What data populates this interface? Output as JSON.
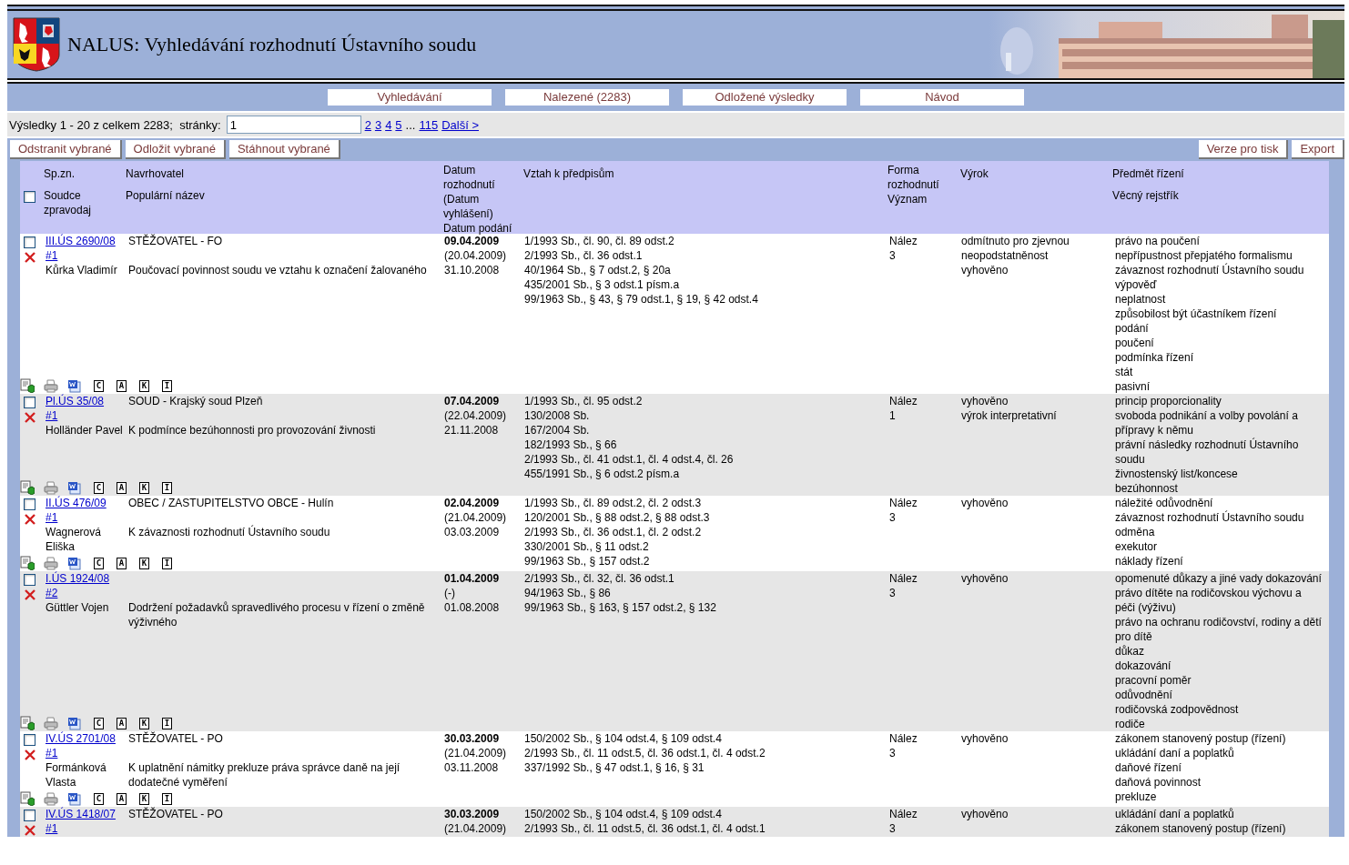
{
  "header": {
    "title": "NALUS: Vyhledávání rozhodnutí Ústavního soudu"
  },
  "nav_tabs": [
    {
      "label": "Vyhledávání"
    },
    {
      "label": "Nalezené (2283)"
    },
    {
      "label": "Odložené výsledky"
    },
    {
      "label": "Návod"
    }
  ],
  "pagination": {
    "summary": "Výsledky 1 - 20 z celkem 2283;  stránky:",
    "page_value": "1",
    "pages": [
      "2",
      "3",
      "4",
      "5"
    ],
    "ellipsis": "...",
    "last_page": "115",
    "next": "Další >"
  },
  "actions_left": [
    "Odstranit vybrané",
    "Odložit vybrané",
    "Stáhnout vybrané"
  ],
  "actions_right": [
    "Verze pro tisk",
    "Export"
  ],
  "table_header": {
    "select_all_checked": false,
    "case_no": "Sp.zn.",
    "judge": "Soudce zpravodaj",
    "petitioner": "Navrhovatel",
    "popular_name": "Populární název",
    "dates": "Datum rozhodnutí (Datum vyhlášení) Datum podání",
    "regulations": "Vztah k předpisům",
    "form": "Forma rozhodnutí",
    "significance": "Význam",
    "verdict": "Výrok",
    "subject": "Předmět řízení",
    "index": "Věcný rejstřík"
  },
  "rows": [
    {
      "checked": false,
      "case_no": "III.ÚS 2690/08",
      "ref": "#1",
      "judge": "Kůrka Vladimír",
      "petitioner": "STĚŽOVATEL - FO",
      "popular_name": "Poučovací povinnost soudu ve vztahu k označení žalovaného",
      "decided": "09.04.2009",
      "announced": "(20.04.2009)",
      "filed": "31.10.2008",
      "regulations": [
        "1/1993 Sb., čl. 90, čl. 89 odst.2",
        "2/1993 Sb., čl. 36 odst.1",
        "40/1964 Sb., § 7 odst.2, § 20a",
        "435/2001 Sb., § 3 odst.1 písm.a",
        "99/1963 Sb., § 43, § 79 odst.1, § 19, § 42 odst.4"
      ],
      "form": "Nález",
      "significance": "3",
      "verdict": [
        "odmítnuto pro zjevnou neopodstatněnost",
        "vyhověno"
      ],
      "subjects": [
        "právo na poučení",
        "nepřípustnost přepjatého formalismu",
        "závaznost rozhodnutí Ústavního soudu",
        "výpověď",
        "neplatnost",
        "způsobilost být účastníkem řízení",
        "podání",
        "poučení",
        "podmínka řízení",
        "stát",
        "pasivní"
      ],
      "letters": [
        "C",
        "A",
        "K",
        "I"
      ]
    },
    {
      "checked": false,
      "case_no": "Pl.ÚS 35/08",
      "ref": "#1",
      "judge": "Holländer Pavel",
      "petitioner": "SOUD - Krajský soud Plzeň",
      "popular_name": "K podmínce bezúhonnosti pro provozování živnosti",
      "decided": "07.04.2009",
      "announced": "(22.04.2009)",
      "filed": "21.11.2008",
      "regulations": [
        "1/1993 Sb., čl. 95 odst.2",
        "130/2008 Sb.",
        "167/2004 Sb.",
        "182/1993 Sb., § 66",
        "2/1993 Sb., čl. 41 odst.1, čl. 4 odst.4, čl. 26",
        "455/1991 Sb., § 6 odst.2 písm.a"
      ],
      "form": "Nález",
      "significance": "1",
      "verdict": [
        "vyhověno",
        "výrok interpretativní"
      ],
      "subjects": [
        "princip proporcionality",
        "svoboda podnikání a volby povolání a přípravy k němu",
        "právní následky rozhodnutí Ústavního soudu",
        "živnostenský list/koncese",
        "bezúhonnost"
      ],
      "letters": [
        "C",
        "A",
        "K",
        "I"
      ]
    },
    {
      "checked": false,
      "case_no": "II.ÚS 476/09",
      "ref": "#1",
      "judge": "Wagnerová Eliška",
      "petitioner": "OBEC / ZASTUPITELSTVO OBCE - Hulín",
      "popular_name": "K závaznosti rozhodnutí Ústavního soudu",
      "decided": "02.04.2009",
      "announced": "(21.04.2009)",
      "filed": "03.03.2009",
      "regulations": [
        "1/1993 Sb., čl. 89 odst.2, čl. 2 odst.3",
        "120/2001 Sb., § 88 odst.2, § 88 odst.3",
        "2/1993 Sb., čl. 36 odst.1, čl. 2 odst.2",
        "330/2001 Sb., § 11 odst.2",
        "99/1963 Sb., § 157 odst.2"
      ],
      "form": "Nález",
      "significance": "3",
      "verdict": [
        "vyhověno"
      ],
      "subjects": [
        "náležité odůvodnění",
        "závaznost rozhodnutí Ústavního soudu",
        "odměna",
        "exekutor",
        "náklady řízení"
      ],
      "letters": [
        "C",
        "A",
        "K",
        "I"
      ]
    },
    {
      "checked": false,
      "case_no": "I.ÚS 1924/08",
      "ref": "#2",
      "judge": "Güttler Vojen",
      "popular_name": "Dodržení požadavků spravedlivého procesu v řízení o změně výživného",
      "decided": "01.04.2009",
      "announced": "(-)",
      "filed": "01.08.2008",
      "regulations": [
        "2/1993 Sb., čl. 32, čl. 36 odst.1",
        "94/1963 Sb., § 86",
        "99/1963 Sb., § 163, § 157 odst.2, § 132"
      ],
      "form": "Nález",
      "significance": "3",
      "verdict": [
        "vyhověno"
      ],
      "subjects": [
        "opomenuté důkazy a jiné vady dokazování",
        "právo dítěte na rodičovskou výchovu a péči (výživu)",
        "právo na ochranu rodičovství, rodiny a dětí",
        "pro dítě",
        "důkaz",
        "dokazování",
        "pracovní poměr",
        "odůvodnění",
        "rodičovská zodpovědnost",
        "rodiče"
      ],
      "letters": [
        "C",
        "A",
        "K",
        "I"
      ]
    },
    {
      "checked": false,
      "case_no": "IV.ÚS 2701/08",
      "ref": "#1",
      "judge": "Formánková Vlasta",
      "petitioner": "STĚŽOVATEL - PO",
      "popular_name": "K uplatnění námitky prekluze práva správce daně na její dodatečné vyměření",
      "decided": "30.03.2009",
      "announced": "(21.04.2009)",
      "filed": "03.11.2008",
      "regulations": [
        "150/2002 Sb., § 104 odst.4, § 109 odst.4",
        "2/1993 Sb., čl. 11 odst.5, čl. 36 odst.1, čl. 4 odst.2",
        "337/1992 Sb., § 47 odst.1, § 16, § 31"
      ],
      "form": "Nález",
      "significance": "3",
      "verdict": [
        "vyhověno"
      ],
      "subjects": [
        "zákonem stanovený postup (řízení)",
        "ukládání daní a poplatků",
        "daňové řízení",
        "daňová povinnost",
        "prekluze"
      ],
      "letters": [
        "C",
        "A",
        "K",
        "I"
      ]
    },
    {
      "checked": false,
      "case_no": "IV.ÚS 1418/07",
      "ref": "#1",
      "petitioner": "STĚŽOVATEL - PO",
      "decided": "30.03.2009",
      "announced": "(21.04.2009)",
      "regulations": [
        "150/2002 Sb., § 104 odst.4, § 109 odst.4",
        "2/1993 Sb., čl. 11 odst.5, čl. 36 odst.1, čl. 4 odst.1"
      ],
      "form": "Nález",
      "significance": "3",
      "verdict": [
        "vyhověno"
      ],
      "subjects": [
        "ukládání daní a poplatků",
        "zákonem stanovený postup (řízení)"
      ]
    }
  ]
}
